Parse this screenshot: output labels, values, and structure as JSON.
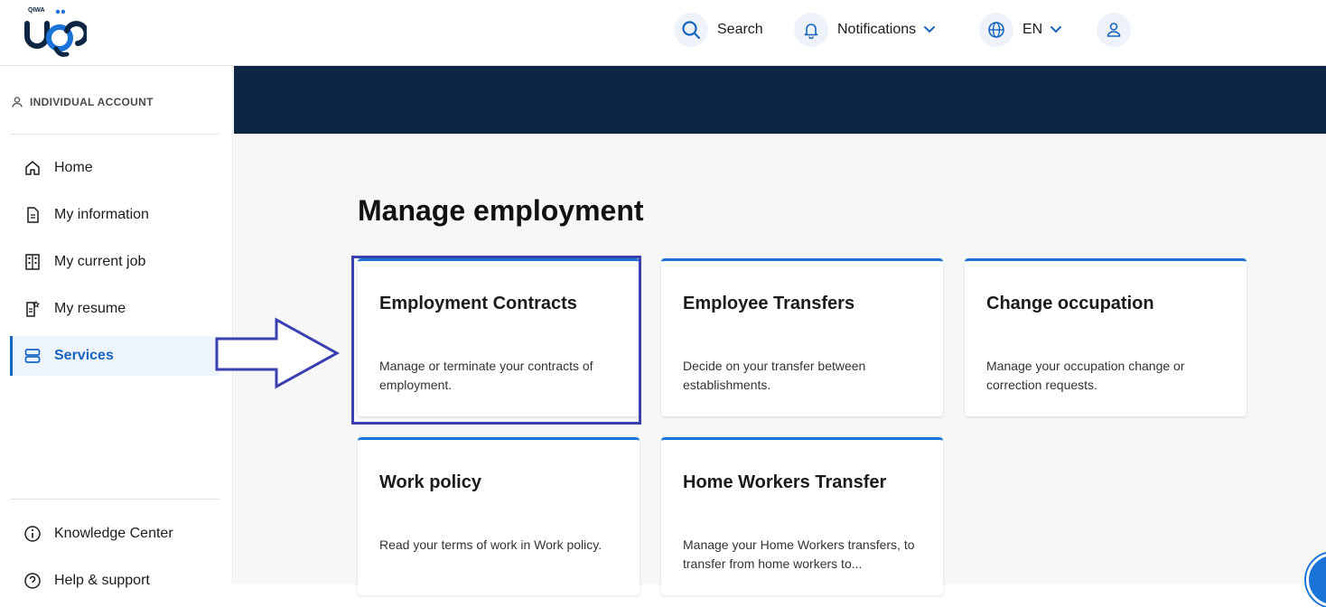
{
  "header": {
    "logo_text": "QIWA",
    "search_label": "Search",
    "notifications_label": "Notifications",
    "language_label": "EN",
    "icons": [
      "search-icon",
      "bell-icon",
      "globe-icon",
      "user-icon",
      "chevron-down-icon"
    ]
  },
  "sidebar": {
    "account_label": "INDIVIDUAL ACCOUNT",
    "items": [
      {
        "label": "Home",
        "icon": "home-icon"
      },
      {
        "label": "My information",
        "icon": "document-icon"
      },
      {
        "label": "My current job",
        "icon": "building-icon"
      },
      {
        "label": "My resume",
        "icon": "resume-icon"
      },
      {
        "label": "Services",
        "icon": "services-icon",
        "active": true
      }
    ],
    "bottom_items": [
      {
        "label": "Knowledge Center",
        "icon": "info-icon"
      },
      {
        "label": "Help & support",
        "icon": "help-icon"
      }
    ]
  },
  "main": {
    "title": "Manage employment",
    "cards": [
      {
        "title": "Employment Contracts",
        "description": "Manage or terminate your contracts of employment."
      },
      {
        "title": "Employee Transfers",
        "description": "Decide on your transfer between establishments."
      },
      {
        "title": "Change occupation",
        "description": "Manage your occupation change or correction requests."
      },
      {
        "title": "Work policy",
        "description": "Read your terms of work in Work policy."
      },
      {
        "title": "Home Workers Transfer",
        "description": "Manage your Home Workers transfers, to transfer from home workers to..."
      }
    ]
  },
  "colors": {
    "accent": "#1a73d6",
    "banner": "#0c2644",
    "highlight": "#3b40b0",
    "active_bg": "#eef4fc"
  }
}
